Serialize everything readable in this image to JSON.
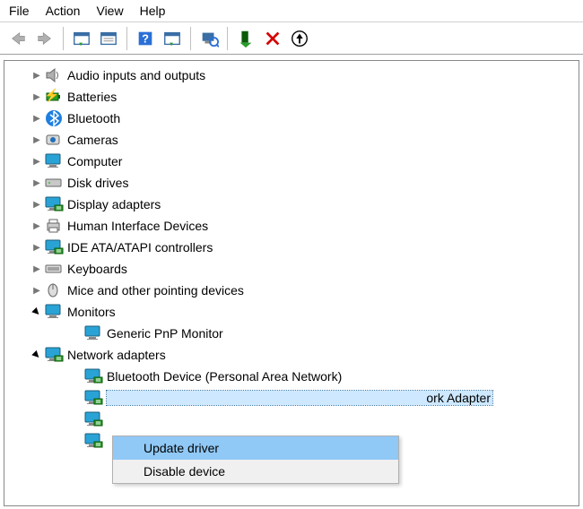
{
  "menubar": {
    "file": "File",
    "action": "Action",
    "view": "View",
    "help": "Help"
  },
  "tree": {
    "audio": "Audio inputs and outputs",
    "batteries": "Batteries",
    "bluetooth": "Bluetooth",
    "cameras": "Cameras",
    "computer": "Computer",
    "disk": "Disk drives",
    "display": "Display adapters",
    "hid": "Human Interface Devices",
    "ide": "IDE ATA/ATAPI controllers",
    "keyboards": "Keyboards",
    "mice": "Mice and other pointing devices",
    "monitors": "Monitors",
    "genericpnp": "Generic PnP Monitor",
    "netadapters": "Network adapters",
    "btpan": "Bluetooth Device (Personal Area Network)",
    "selected_suffix": "ork Adapter"
  },
  "ctx": {
    "update": "Update driver",
    "disable": "Disable device"
  }
}
